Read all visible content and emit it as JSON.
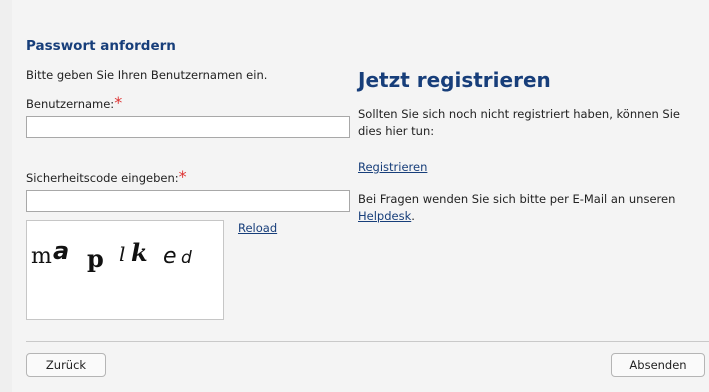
{
  "request": {
    "title": "Passwort anfordern",
    "intro": "Bitte geben Sie Ihren Benutzernamen ein.",
    "username_label": "Benutzername:",
    "username_value": "",
    "captcha_label": "Sicherheitscode eingeben:",
    "captcha_value": "",
    "required_marker": "*",
    "captcha_text": "ma p lk ed",
    "reload_label": "Reload"
  },
  "register": {
    "title": "Jetzt registrieren",
    "text": "Sollten Sie sich noch nicht registriert haben, können Sie dies hier tun:",
    "link": "Registrieren",
    "help_text": "Bei Fragen wenden Sie sich bitte per E-Mail an unseren",
    "help_link": "Helpdesk",
    "help_end": "."
  },
  "footer": {
    "back_label": "Zurück",
    "submit_label": "Absenden"
  },
  "colors": {
    "accent": "#173e7a",
    "required": "#dd3333"
  }
}
